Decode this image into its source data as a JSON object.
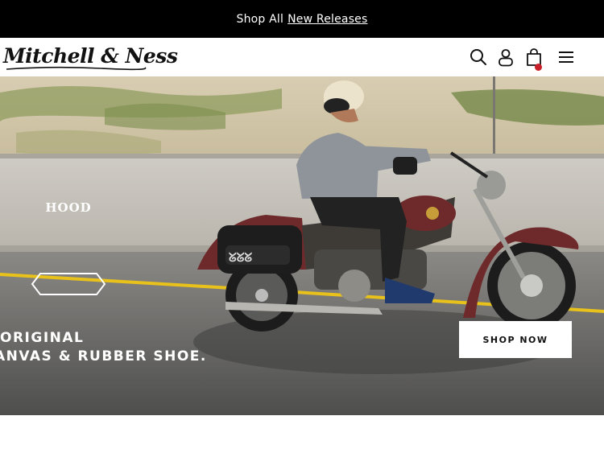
{
  "promo": {
    "prefix": "Shop All",
    "link_label": "New Releases"
  },
  "header": {
    "logo_text": "Mitchell & Ness",
    "icons": [
      "search-icon",
      "account-icon",
      "cart-icon",
      "menu-icon"
    ],
    "cart_indicator_color": "#c8202a"
  },
  "hero": {
    "badge_text": "HOOD",
    "headline_line1": "ORIGINAL",
    "headline_line2": "ANVAS & RUBBER SHOE.",
    "cta_label": "SHOP NOW"
  },
  "colors": {
    "promo_bg": "#000000",
    "header_bg": "#ffffff",
    "road_line": "#e8c21a",
    "bike_tank": "#6e2a2a"
  }
}
